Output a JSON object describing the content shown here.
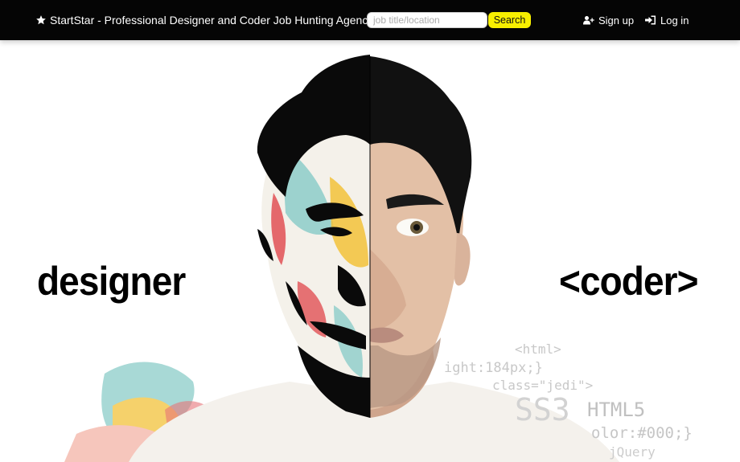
{
  "navbar": {
    "brand": "StartStar - Professional Designer and Coder Job Hunting Agency",
    "brand_icon": "star-icon",
    "search": {
      "placeholder": "job title/location",
      "value": ""
    },
    "search_button": "Search",
    "signup": {
      "label": "Sign up",
      "icon": "user-plus-icon"
    },
    "login": {
      "label": "Log in",
      "icon": "sign-in-icon"
    }
  },
  "hero": {
    "designer_label": "designer",
    "coder_label": "<coder>",
    "code_lines": [
      "<html>",
      "ight:184px;}",
      "class=\"jedi\">",
      "SS3",
      "HTML5",
      "olor:#000;}",
      "jQuery"
    ]
  },
  "colors": {
    "navbar_bg": "#050505",
    "search_button_bg": "#f7ef00",
    "paint_teal": "#8ccdc9",
    "paint_yellow": "#f2c23a",
    "paint_red": "#e0464b",
    "paint_pink": "#f3b3a6"
  }
}
